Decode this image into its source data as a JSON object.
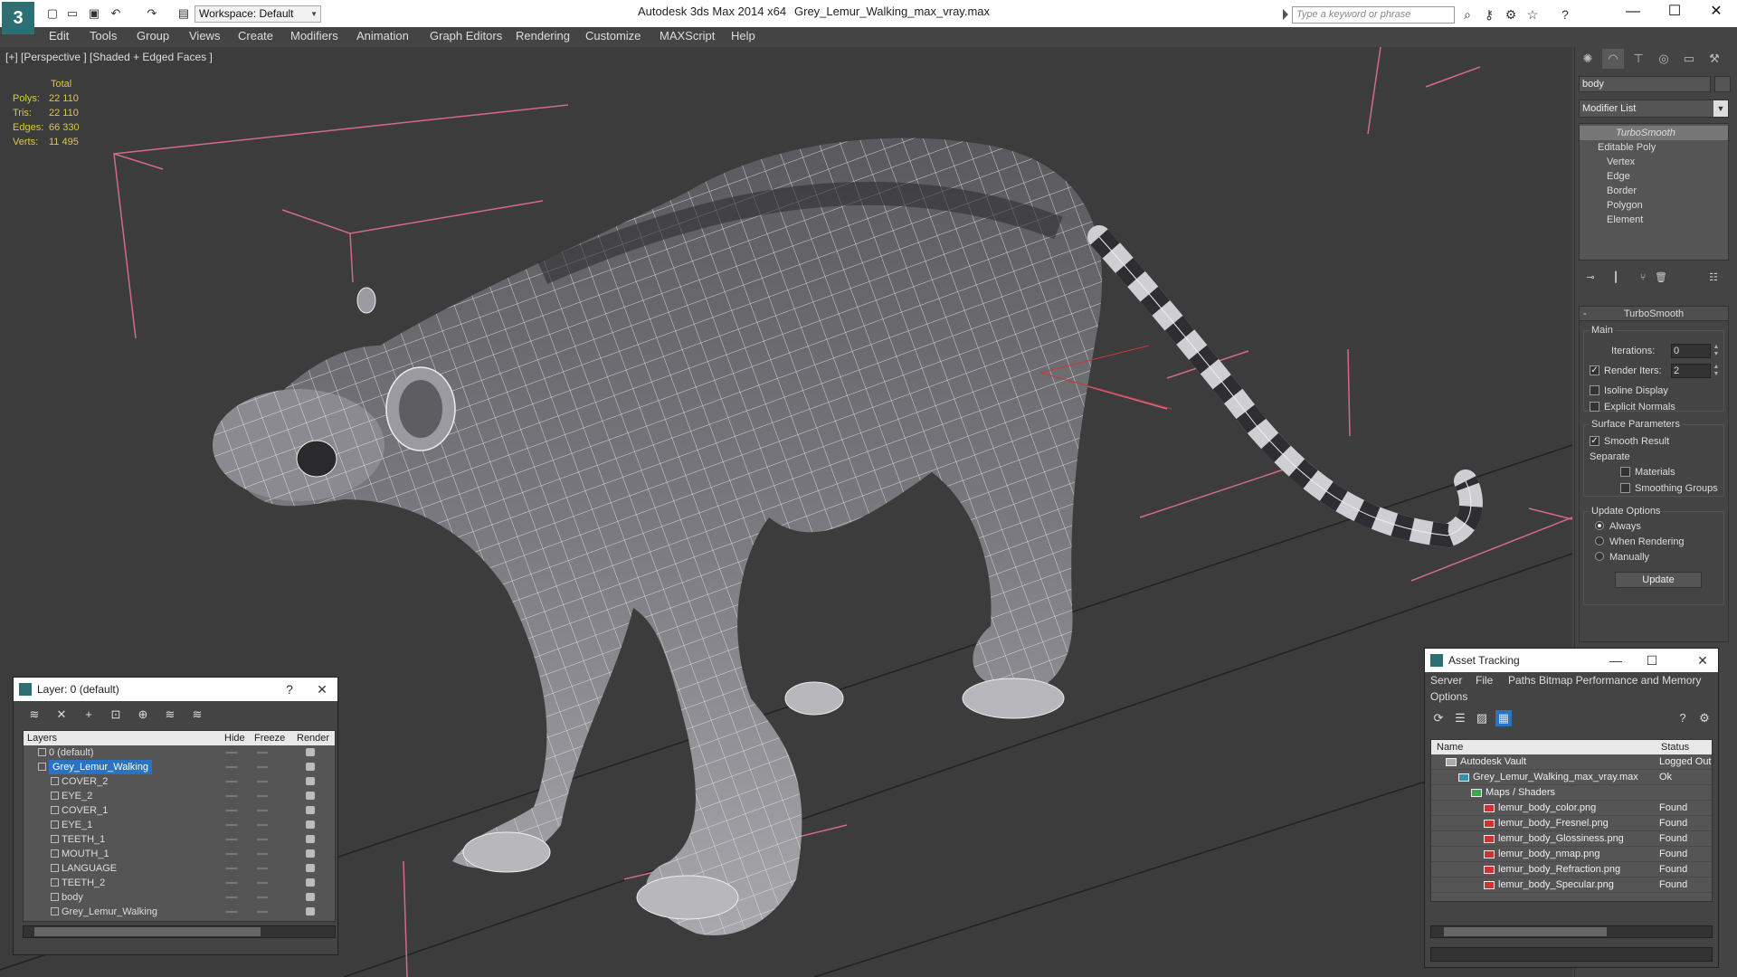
{
  "titlebar": {
    "app_title": "Autodesk 3ds Max  2014 x64",
    "file_name": "Grey_Lemur_Walking_max_vray.max",
    "workspace": "Workspace: Default",
    "search_placeholder": "Type a keyword or phrase"
  },
  "menu": [
    "Edit",
    "Tools",
    "Group",
    "Views",
    "Create",
    "Modifiers",
    "Animation",
    "Graph Editors",
    "Rendering",
    "Customize",
    "MAXScript",
    "Help"
  ],
  "viewport": {
    "label": "[+] [Perspective ] [Shaded + Edged Faces ]",
    "stats": {
      "header": "Total",
      "rows": [
        {
          "label": "Polys:",
          "value": "22 110"
        },
        {
          "label": "Tris:",
          "value": "22 110"
        },
        {
          "label": "Edges:",
          "value": "66 330"
        },
        {
          "label": "Verts:",
          "value": "11 495"
        }
      ]
    }
  },
  "command_panel": {
    "object_name": "body",
    "modifier_list": "Modifier List",
    "stack": [
      "TurboSmooth",
      "Editable Poly",
      "Vertex",
      "Edge",
      "Border",
      "Polygon",
      "Element"
    ],
    "rollout_title": "TurboSmooth",
    "main_group": "Main",
    "iterations_label": "Iterations:",
    "iterations_value": "0",
    "render_iters_label": "Render Iters:",
    "render_iters_value": "2",
    "isoline_display": "Isoline Display",
    "explicit_normals": "Explicit Normals",
    "surface_group": "Surface Parameters",
    "smooth_result": "Smooth Result",
    "separate": "Separate",
    "materials": "Materials",
    "smoothing_groups": "Smoothing Groups",
    "update_group": "Update Options",
    "always": "Always",
    "when_rendering": "When Rendering",
    "manually": "Manually",
    "update_button": "Update"
  },
  "layer_dialog": {
    "title": "Layer: 0 (default)",
    "help": "?",
    "columns": [
      "Layers",
      "Hide",
      "Freeze",
      "Render"
    ],
    "rows": [
      {
        "name": "0 (default)",
        "indent": 0,
        "kind": "layer"
      },
      {
        "name": "Grey_Lemur_Walking",
        "indent": 0,
        "kind": "layer-selected"
      },
      {
        "name": "COVER_2",
        "indent": 1,
        "kind": "object"
      },
      {
        "name": "EYE_2",
        "indent": 1,
        "kind": "object"
      },
      {
        "name": "COVER_1",
        "indent": 1,
        "kind": "object"
      },
      {
        "name": "EYE_1",
        "indent": 1,
        "kind": "object"
      },
      {
        "name": "TEETH_1",
        "indent": 1,
        "kind": "object"
      },
      {
        "name": "MOUTH_1",
        "indent": 1,
        "kind": "object"
      },
      {
        "name": "LANGUAGE",
        "indent": 1,
        "kind": "object"
      },
      {
        "name": "TEETH_2",
        "indent": 1,
        "kind": "object"
      },
      {
        "name": "body",
        "indent": 1,
        "kind": "object"
      },
      {
        "name": "Grey_Lemur_Walking",
        "indent": 1,
        "kind": "object"
      }
    ]
  },
  "asset_dialog": {
    "title": "Asset Tracking",
    "menu": [
      "Server",
      "File",
      "Paths",
      "Bitmap Performance and Memory",
      "Options"
    ],
    "columns": [
      "Name",
      "Status"
    ],
    "rows": [
      {
        "name": "Autodesk Vault",
        "status": "Logged Out",
        "indent": 0,
        "kind": "vault"
      },
      {
        "name": "Grey_Lemur_Walking_max_vray.max",
        "status": "Ok",
        "indent": 1,
        "kind": "max"
      },
      {
        "name": "Maps / Shaders",
        "status": "",
        "indent": 2,
        "kind": "folder"
      },
      {
        "name": "lemur_body_color.png",
        "status": "Found",
        "indent": 3,
        "kind": "png"
      },
      {
        "name": "lemur_body_Fresnel.png",
        "status": "Found",
        "indent": 3,
        "kind": "png"
      },
      {
        "name": "lemur_body_Glossiness.png",
        "status": "Found",
        "indent": 3,
        "kind": "png"
      },
      {
        "name": "lemur_body_nmap.png",
        "status": "Found",
        "indent": 3,
        "kind": "png"
      },
      {
        "name": "lemur_body_Refraction.png",
        "status": "Found",
        "indent": 3,
        "kind": "png"
      },
      {
        "name": "lemur_body_Specular.png",
        "status": "Found",
        "indent": 3,
        "kind": "png"
      }
    ]
  },
  "colors": {
    "stats_yellow": "#d8c94c",
    "selection_blue": "#2a72c4",
    "bbox_pink": "#d46a86"
  }
}
